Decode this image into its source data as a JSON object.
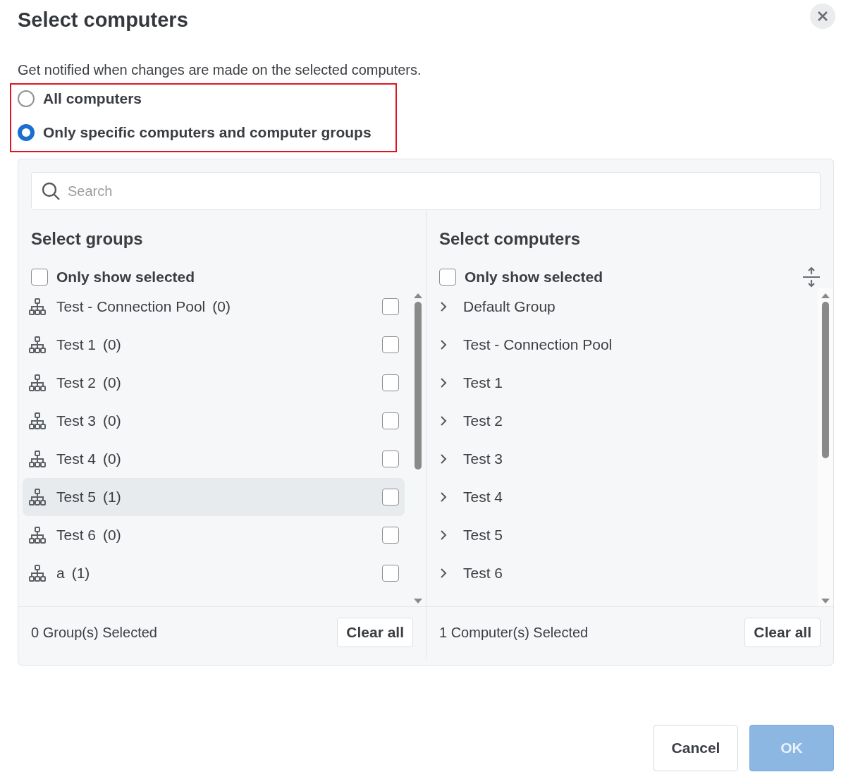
{
  "dialog": {
    "title": "Select computers",
    "description": "Get notified when changes are made on the selected computers."
  },
  "scope_options": [
    {
      "label": "All computers",
      "selected": false
    },
    {
      "label": "Only specific computers and computer groups",
      "selected": true
    }
  ],
  "search": {
    "placeholder": "Search"
  },
  "groups_panel": {
    "heading": "Select groups",
    "filter": {
      "label": "Only show selected",
      "checked": false
    },
    "items": [
      {
        "name": "Test - Connection Pool",
        "count": "(0)",
        "checked": false,
        "highlighted": false
      },
      {
        "name": "Test 1",
        "count": "(0)",
        "checked": false,
        "highlighted": false
      },
      {
        "name": "Test 2",
        "count": "(0)",
        "checked": false,
        "highlighted": false
      },
      {
        "name": "Test 3",
        "count": "(0)",
        "checked": false,
        "highlighted": false
      },
      {
        "name": "Test 4",
        "count": "(0)",
        "checked": false,
        "highlighted": false
      },
      {
        "name": "Test 5",
        "count": "(1)",
        "checked": false,
        "highlighted": true
      },
      {
        "name": "Test 6",
        "count": "(0)",
        "checked": false,
        "highlighted": false
      },
      {
        "name": "a",
        "count": "(1)",
        "checked": false,
        "highlighted": false
      }
    ],
    "status": "0 Group(s) Selected",
    "clear_button": "Clear all"
  },
  "computers_panel": {
    "heading": "Select computers",
    "filter": {
      "label": "Only show selected",
      "checked": false
    },
    "items": [
      {
        "name": "Default Group",
        "expanded": false
      },
      {
        "name": "Test - Connection Pool",
        "expanded": false
      },
      {
        "name": "Test 1",
        "expanded": false
      },
      {
        "name": "Test 2",
        "expanded": false
      },
      {
        "name": "Test 3",
        "expanded": false
      },
      {
        "name": "Test 4",
        "expanded": false
      },
      {
        "name": "Test 5",
        "expanded": false
      },
      {
        "name": "Test 6",
        "expanded": false
      }
    ],
    "status": "1 Computer(s) Selected",
    "clear_button": "Clear all"
  },
  "buttons": [
    {
      "label": "Cancel",
      "kind": "secondary",
      "disabled": false
    },
    {
      "label": "OK",
      "kind": "primary",
      "disabled": true
    }
  ]
}
